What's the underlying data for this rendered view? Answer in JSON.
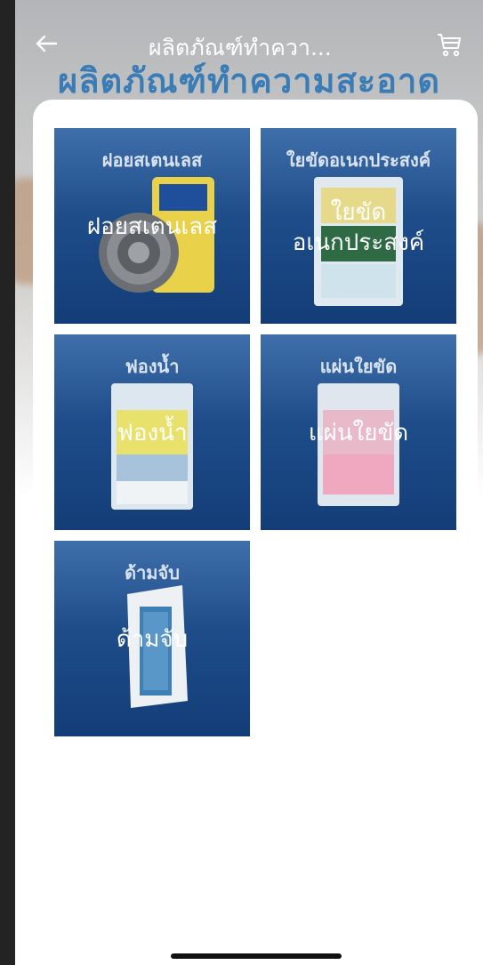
{
  "header": {
    "title": "ผลิตภัณฑ์ทำควา...",
    "back_icon": "arrow-left-icon",
    "cart_icon": "shopping-cart-icon"
  },
  "banner": {
    "text": "ผลิตภัณฑ์ทำความสะอาด"
  },
  "categories": [
    {
      "heading": "ฝอยสเตนเลส",
      "label": "ฝอยสเตนเลส"
    },
    {
      "heading": "ใยขัดอเนกประสงค์",
      "label_line1": "ใยขัด",
      "label_line2": "อเนกประสงค์"
    },
    {
      "heading": "ฟองน้ำ",
      "label": "ฟองน้ำ"
    },
    {
      "heading": "แผ่นใยขัด",
      "label": "แผ่นใยขัด"
    },
    {
      "heading": "ด้ามจับ",
      "label": "ด้ามจับ"
    }
  ],
  "colors": {
    "tile_top": "#3f6faa",
    "tile_bottom": "#133d77",
    "banner": "#2c75b5"
  }
}
